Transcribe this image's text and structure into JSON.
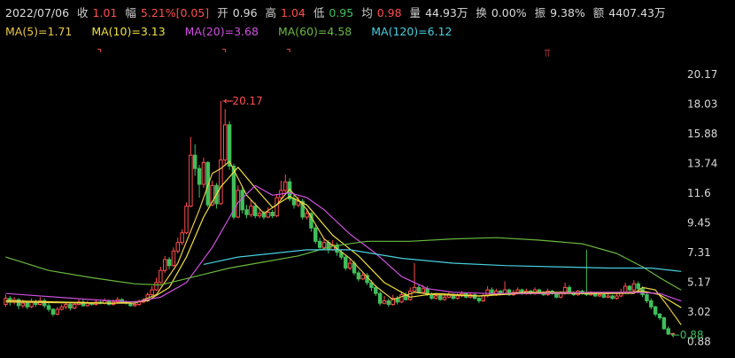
{
  "header": {
    "date": "2022/07/06",
    "close_label": "收",
    "close": "1.01",
    "change_label": "幅",
    "change": "5.21%[0.05]",
    "open_label": "开",
    "open": "0.96",
    "high_label": "高",
    "high": "1.04",
    "low_label": "低",
    "low": "0.95",
    "avg_label": "均",
    "avg": "0.98",
    "vol_label": "量",
    "vol": "44.93万",
    "turn_label": "换",
    "turn": "0.00%",
    "amp_label": "振",
    "amp": "9.38%",
    "amt_label": "额",
    "amt": "4407.43万"
  },
  "ma": [
    {
      "text": "MA(5)=1.71",
      "color": "#e8c84a"
    },
    {
      "text": "MA(10)=3.13",
      "color": "#f0e040"
    },
    {
      "text": "MA(20)=3.68",
      "color": "#d050e0"
    },
    {
      "text": "MA(60)=4.58",
      "color": "#6ab840"
    },
    {
      "text": "MA(120)=6.12",
      "color": "#48d0e0"
    }
  ],
  "colors": {
    "up": "#ff4d4f",
    "down": "#3fbf5a",
    "ma5": "#e8c84a",
    "ma10": "#f0e040",
    "ma20": "#d050e0",
    "ma60": "#6ab840",
    "ma120": "#48d0e0"
  },
  "chart_data": {
    "type": "candlestick",
    "y_ticks": [
      "20.17",
      "18.03",
      "15.88",
      "13.74",
      "11.6",
      "9.45",
      "7.31",
      "5.17",
      "3.02",
      "0.88"
    ],
    "ylim": [
      0.3,
      22.5
    ],
    "max_label": "20.17",
    "min_label": "0.88",
    "candles": [
      [
        3.4,
        3.9,
        4.2,
        3.2
      ],
      [
        3.9,
        3.6,
        4.1,
        3.3
      ],
      [
        3.6,
        3.8,
        4.0,
        3.4
      ],
      [
        3.8,
        3.3,
        3.9,
        3.0
      ],
      [
        3.3,
        3.5,
        3.8,
        3.1
      ],
      [
        3.5,
        3.2,
        3.7,
        3.0
      ],
      [
        3.2,
        3.6,
        3.9,
        3.1
      ],
      [
        3.6,
        3.4,
        3.8,
        3.2
      ],
      [
        3.4,
        3.7,
        4.0,
        3.3
      ],
      [
        3.7,
        3.3,
        3.9,
        3.1
      ],
      [
        3.3,
        3.0,
        3.5,
        2.8
      ],
      [
        3.0,
        2.6,
        3.1,
        2.4
      ],
      [
        2.6,
        3.0,
        3.2,
        2.5
      ],
      [
        3.0,
        3.2,
        3.4,
        2.9
      ],
      [
        3.2,
        3.4,
        3.6,
        3.0
      ],
      [
        3.4,
        3.1,
        3.5,
        2.9
      ],
      [
        3.1,
        3.4,
        3.6,
        3.0
      ],
      [
        3.4,
        3.6,
        3.8,
        3.3
      ],
      [
        3.6,
        3.3,
        3.8,
        3.2
      ],
      [
        3.3,
        3.5,
        3.7,
        3.2
      ],
      [
        3.5,
        3.4,
        3.6,
        3.3
      ],
      [
        3.4,
        3.6,
        3.8,
        3.3
      ],
      [
        3.6,
        3.5,
        3.7,
        3.4
      ],
      [
        3.5,
        3.7,
        3.9,
        3.4
      ],
      [
        3.7,
        3.4,
        3.8,
        3.3
      ],
      [
        3.4,
        3.6,
        3.8,
        3.3
      ],
      [
        3.6,
        3.8,
        4.0,
        3.5
      ],
      [
        3.8,
        3.6,
        3.9,
        3.5
      ],
      [
        3.6,
        3.5,
        3.7,
        3.4
      ],
      [
        3.5,
        3.3,
        3.6,
        3.2
      ],
      [
        3.3,
        3.4,
        3.5,
        3.2
      ],
      [
        3.4,
        3.6,
        3.8,
        3.3
      ],
      [
        3.6,
        3.7,
        3.9,
        3.5
      ],
      [
        3.7,
        4.2,
        4.4,
        3.6
      ],
      [
        4.2,
        4.6,
        4.9,
        4.1
      ],
      [
        4.6,
        5.2,
        5.6,
        4.5
      ],
      [
        5.2,
        6.2,
        6.5,
        5.1
      ],
      [
        6.2,
        7.1,
        7.4,
        6.0
      ],
      [
        7.1,
        6.6,
        7.3,
        6.3
      ],
      [
        6.6,
        7.8,
        8.1,
        6.5
      ],
      [
        7.8,
        8.5,
        8.9,
        7.6
      ],
      [
        8.5,
        9.3,
        9.6,
        8.3
      ],
      [
        9.3,
        11.5,
        11.8,
        9.2
      ],
      [
        11.5,
        15.7,
        17.2,
        11.4
      ],
      [
        15.7,
        14.6,
        16.6,
        14.0
      ],
      [
        14.6,
        13.3,
        14.9,
        12.2
      ],
      [
        13.3,
        15.1,
        15.5,
        13.0
      ],
      [
        15.1,
        11.6,
        15.2,
        11.4
      ],
      [
        11.6,
        13.2,
        13.6,
        11.5
      ],
      [
        13.2,
        11.7,
        13.4,
        11.3
      ],
      [
        11.7,
        15.3,
        20.17,
        11.6
      ],
      [
        15.3,
        18.2,
        19.5,
        14.8
      ],
      [
        18.2,
        14.8,
        18.5,
        14.5
      ],
      [
        14.8,
        10.6,
        15.0,
        10.4
      ],
      [
        10.6,
        12.8,
        13.2,
        10.5
      ],
      [
        12.8,
        11.2,
        13.1,
        10.9
      ],
      [
        11.2,
        10.8,
        11.6,
        10.5
      ],
      [
        10.8,
        11.5,
        12.0,
        10.6
      ],
      [
        11.5,
        10.7,
        11.8,
        10.5
      ],
      [
        10.7,
        10.9,
        11.3,
        10.5
      ],
      [
        10.9,
        10.6,
        11.1,
        10.4
      ],
      [
        10.6,
        11.0,
        11.4,
        10.5
      ],
      [
        11.0,
        10.7,
        11.2,
        10.5
      ],
      [
        10.7,
        12.2,
        12.5,
        10.6
      ],
      [
        12.2,
        12.8,
        13.6,
        12.0
      ],
      [
        12.8,
        13.5,
        14.1,
        12.6
      ],
      [
        13.5,
        12.1,
        13.8,
        11.9
      ],
      [
        12.1,
        11.6,
        12.5,
        11.3
      ],
      [
        11.6,
        11.9,
        12.3,
        11.4
      ],
      [
        11.9,
        10.6,
        12.1,
        10.4
      ],
      [
        10.6,
        10.9,
        11.3,
        10.4
      ],
      [
        10.9,
        9.7,
        11.0,
        9.4
      ],
      [
        9.7,
        8.6,
        9.9,
        8.4
      ],
      [
        8.6,
        8.1,
        8.9,
        7.9
      ],
      [
        8.1,
        8.5,
        8.9,
        7.9
      ],
      [
        8.5,
        7.9,
        8.7,
        7.6
      ],
      [
        7.9,
        8.3,
        8.7,
        7.8
      ],
      [
        8.3,
        7.7,
        8.5,
        7.4
      ],
      [
        7.7,
        7.3,
        7.9,
        7.1
      ],
      [
        7.3,
        6.4,
        7.5,
        6.2
      ],
      [
        6.4,
        6.8,
        7.2,
        6.2
      ],
      [
        6.8,
        6.0,
        7.0,
        5.8
      ],
      [
        6.0,
        5.5,
        6.2,
        5.3
      ],
      [
        5.5,
        5.8,
        6.1,
        5.4
      ],
      [
        5.8,
        5.2,
        6.0,
        5.0
      ],
      [
        5.2,
        4.8,
        5.4,
        4.5
      ],
      [
        4.8,
        4.3,
        5.0,
        4.1
      ],
      [
        4.3,
        3.5,
        4.5,
        3.3
      ],
      [
        3.5,
        3.7,
        4.1,
        3.4
      ],
      [
        3.7,
        3.4,
        3.9,
        3.2
      ],
      [
        3.4,
        3.9,
        4.2,
        3.3
      ],
      [
        3.9,
        3.6,
        4.1,
        3.4
      ],
      [
        3.6,
        4.2,
        4.5,
        3.5
      ],
      [
        4.2,
        3.8,
        4.4,
        3.7
      ],
      [
        3.8,
        4.5,
        4.8,
        3.7
      ],
      [
        4.5,
        4.8,
        6.8,
        4.4
      ],
      [
        4.8,
        4.4,
        5.0,
        4.3
      ],
      [
        4.4,
        4.7,
        5.0,
        4.3
      ],
      [
        4.7,
        4.2,
        4.9,
        4.1
      ],
      [
        4.2,
        3.9,
        4.4,
        3.8
      ],
      [
        3.9,
        4.1,
        4.3,
        3.8
      ],
      [
        4.1,
        3.8,
        4.2,
        3.7
      ],
      [
        3.8,
        4.0,
        4.2,
        3.7
      ],
      [
        4.0,
        4.2,
        4.4,
        3.9
      ],
      [
        4.2,
        3.9,
        4.3,
        3.8
      ],
      [
        3.9,
        4.1,
        4.3,
        3.8
      ],
      [
        4.1,
        4.3,
        4.5,
        4.0
      ],
      [
        4.3,
        4.0,
        4.4,
        3.9
      ],
      [
        4.0,
        4.2,
        4.4,
        3.9
      ],
      [
        4.2,
        3.9,
        4.3,
        3.8
      ],
      [
        3.9,
        3.7,
        4.0,
        3.5
      ],
      [
        3.7,
        4.1,
        4.3,
        3.6
      ],
      [
        4.1,
        4.6,
        4.9,
        4.0
      ],
      [
        4.6,
        4.2,
        4.8,
        4.1
      ],
      [
        4.2,
        4.5,
        4.7,
        4.1
      ],
      [
        4.5,
        4.3,
        4.6,
        4.2
      ],
      [
        4.3,
        4.6,
        5.3,
        4.2
      ],
      [
        4.6,
        4.2,
        4.7,
        4.1
      ],
      [
        4.2,
        4.4,
        4.6,
        4.1
      ],
      [
        4.4,
        4.6,
        4.8,
        4.3
      ],
      [
        4.6,
        4.3,
        4.7,
        4.2
      ],
      [
        4.3,
        4.5,
        4.7,
        4.2
      ],
      [
        4.5,
        4.3,
        4.6,
        4.2
      ],
      [
        4.3,
        4.6,
        4.8,
        4.2
      ],
      [
        4.6,
        4.4,
        4.7,
        4.3
      ],
      [
        4.4,
        4.2,
        4.5,
        4.1
      ],
      [
        4.2,
        4.5,
        4.7,
        4.1
      ],
      [
        4.5,
        4.3,
        4.6,
        4.2
      ],
      [
        4.3,
        4.0,
        4.4,
        3.9
      ],
      [
        4.0,
        4.3,
        4.5,
        3.9
      ],
      [
        4.3,
        4.8,
        5.2,
        4.2
      ],
      [
        4.8,
        4.4,
        5.0,
        4.3
      ],
      [
        4.4,
        4.2,
        4.5,
        4.1
      ],
      [
        4.2,
        4.5,
        4.6,
        4.1
      ],
      [
        4.5,
        4.3,
        4.6,
        4.2
      ],
      [
        4.3,
        4.2,
        7.9,
        4.1
      ],
      [
        4.2,
        4.3,
        4.5,
        4.1
      ],
      [
        4.3,
        4.1,
        4.4,
        4.0
      ],
      [
        4.1,
        4.2,
        4.4,
        4.0
      ],
      [
        4.2,
        4.0,
        4.3,
        3.9
      ],
      [
        4.0,
        4.1,
        4.3,
        3.9
      ],
      [
        4.1,
        3.9,
        4.2,
        3.8
      ],
      [
        3.9,
        4.1,
        4.3,
        3.8
      ],
      [
        4.1,
        4.4,
        4.7,
        4.0
      ],
      [
        4.4,
        4.9,
        5.2,
        4.3
      ],
      [
        4.9,
        4.6,
        5.0,
        4.5
      ],
      [
        4.6,
        5.1,
        5.4,
        4.5
      ],
      [
        5.1,
        4.7,
        5.3,
        4.6
      ],
      [
        4.7,
        4.2,
        4.9,
        4.0
      ],
      [
        4.2,
        3.7,
        4.4,
        3.5
      ],
      [
        3.7,
        3.2,
        3.9,
        3.0
      ],
      [
        3.2,
        2.6,
        3.3,
        2.4
      ],
      [
        2.6,
        2.3,
        2.7,
        2.1
      ],
      [
        2.3,
        1.4,
        2.4,
        1.3
      ],
      [
        1.4,
        0.96,
        1.6,
        0.88
      ],
      [
        0.96,
        1.01,
        1.04,
        0.88
      ]
    ],
    "ma_series": {
      "ma5": [
        [
          0,
          3.6
        ],
        [
          20,
          3.5
        ],
        [
          30,
          3.5
        ],
        [
          35,
          4.2
        ],
        [
          40,
          6.8
        ],
        [
          45,
          11.2
        ],
        [
          48,
          14.2
        ],
        [
          50,
          14.6
        ],
        [
          52,
          15.2
        ],
        [
          56,
          12.4
        ],
        [
          60,
          10.9
        ],
        [
          63,
          11.6
        ],
        [
          66,
          12.9
        ],
        [
          70,
          11.2
        ],
        [
          74,
          8.8
        ],
        [
          80,
          7.2
        ],
        [
          86,
          4.9
        ],
        [
          90,
          3.8
        ],
        [
          95,
          4.4
        ],
        [
          100,
          4.2
        ],
        [
          110,
          4.1
        ],
        [
          120,
          4.4
        ],
        [
          130,
          4.4
        ],
        [
          140,
          4.3
        ],
        [
          146,
          4.3
        ],
        [
          148,
          4.8
        ],
        [
          151,
          4.6
        ],
        [
          154,
          3.2
        ],
        [
          157,
          1.71
        ]
      ],
      "ma10": [
        [
          0,
          3.7
        ],
        [
          25,
          3.5
        ],
        [
          33,
          3.7
        ],
        [
          38,
          4.8
        ],
        [
          42,
          7.3
        ],
        [
          46,
          10.6
        ],
        [
          50,
          13.1
        ],
        [
          54,
          14.7
        ],
        [
          58,
          13.0
        ],
        [
          62,
          11.4
        ],
        [
          66,
          12.3
        ],
        [
          70,
          11.6
        ],
        [
          76,
          9.1
        ],
        [
          82,
          7.4
        ],
        [
          88,
          5.2
        ],
        [
          94,
          4.0
        ],
        [
          100,
          4.3
        ],
        [
          110,
          4.1
        ],
        [
          120,
          4.3
        ],
        [
          130,
          4.3
        ],
        [
          140,
          4.3
        ],
        [
          148,
          4.5
        ],
        [
          152,
          4.2
        ],
        [
          157,
          3.13
        ]
      ],
      "ma20": [
        [
          0,
          4.3
        ],
        [
          20,
          3.8
        ],
        [
          30,
          3.6
        ],
        [
          36,
          4.0
        ],
        [
          42,
          5.2
        ],
        [
          48,
          8.1
        ],
        [
          54,
          11.8
        ],
        [
          58,
          13.2
        ],
        [
          62,
          12.4
        ],
        [
          66,
          12.6
        ],
        [
          70,
          12.2
        ],
        [
          74,
          11.2
        ],
        [
          80,
          9.2
        ],
        [
          86,
          7.6
        ],
        [
          92,
          5.7
        ],
        [
          98,
          4.7
        ],
        [
          104,
          4.4
        ],
        [
          112,
          4.3
        ],
        [
          124,
          4.3
        ],
        [
          136,
          4.4
        ],
        [
          146,
          4.4
        ],
        [
          152,
          4.3
        ],
        [
          157,
          3.68
        ]
      ],
      "ma60": [
        [
          0,
          7.3
        ],
        [
          10,
          6.2
        ],
        [
          20,
          5.6
        ],
        [
          30,
          5.1
        ],
        [
          36,
          5.0
        ],
        [
          44,
          5.7
        ],
        [
          52,
          6.4
        ],
        [
          60,
          6.9
        ],
        [
          68,
          7.4
        ],
        [
          76,
          8.2
        ],
        [
          84,
          8.6
        ],
        [
          94,
          8.6
        ],
        [
          104,
          8.8
        ],
        [
          114,
          8.9
        ],
        [
          124,
          8.7
        ],
        [
          134,
          8.4
        ],
        [
          142,
          7.6
        ],
        [
          148,
          6.5
        ],
        [
          152,
          5.6
        ],
        [
          157,
          4.58
        ]
      ],
      "ma120": [
        [
          46,
          6.7
        ],
        [
          54,
          7.3
        ],
        [
          62,
          7.6
        ],
        [
          70,
          7.9
        ],
        [
          80,
          7.9
        ],
        [
          92,
          7.2
        ],
        [
          104,
          6.8
        ],
        [
          116,
          6.6
        ],
        [
          128,
          6.5
        ],
        [
          140,
          6.4
        ],
        [
          150,
          6.4
        ],
        [
          157,
          6.12
        ]
      ]
    },
    "markers": [
      {
        "index": 22,
        "label": "⌝"
      },
      {
        "index": 51,
        "label": "⌝"
      },
      {
        "index": 66,
        "label": "⌝"
      },
      {
        "index": 126,
        "label": "⫪"
      }
    ]
  }
}
